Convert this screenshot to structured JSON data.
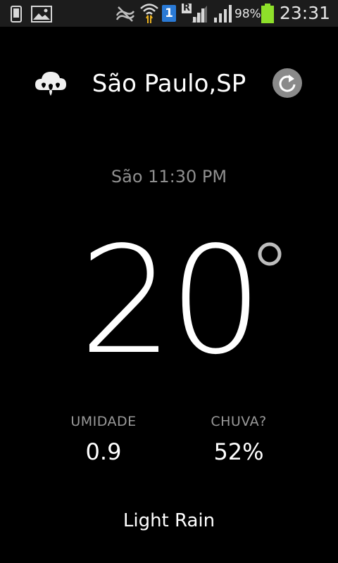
{
  "status_bar": {
    "battery_percent": "98%",
    "time": "23:31",
    "sim_badge": "1",
    "roaming_badge": "R",
    "icons": [
      "phone-icon",
      "gallery-icon",
      "mute-icon",
      "wifi-icon",
      "sim-icon",
      "roaming-signal-icon",
      "signal-icon",
      "battery-icon"
    ],
    "battery_level": 0.98,
    "battery_color": "#8ee02a"
  },
  "header": {
    "city": "São Paulo,SP",
    "weather_icon": "cloud-rain-icon",
    "refresh_icon": "refresh-icon"
  },
  "update_time": "São 11:30 PM",
  "temperature": {
    "value": "20",
    "unit_symbol": "°"
  },
  "stats": {
    "humidity": {
      "label": "UMIDADE",
      "value": "0.9"
    },
    "rain": {
      "label": "CHUVA?",
      "value": "52%"
    }
  },
  "summary": "Light Rain",
  "colors": {
    "background": "#000000",
    "status_bar": "#1c1c1c",
    "secondary_text": "#8f8f8f",
    "refresh_circle": "#8a8a8a"
  }
}
